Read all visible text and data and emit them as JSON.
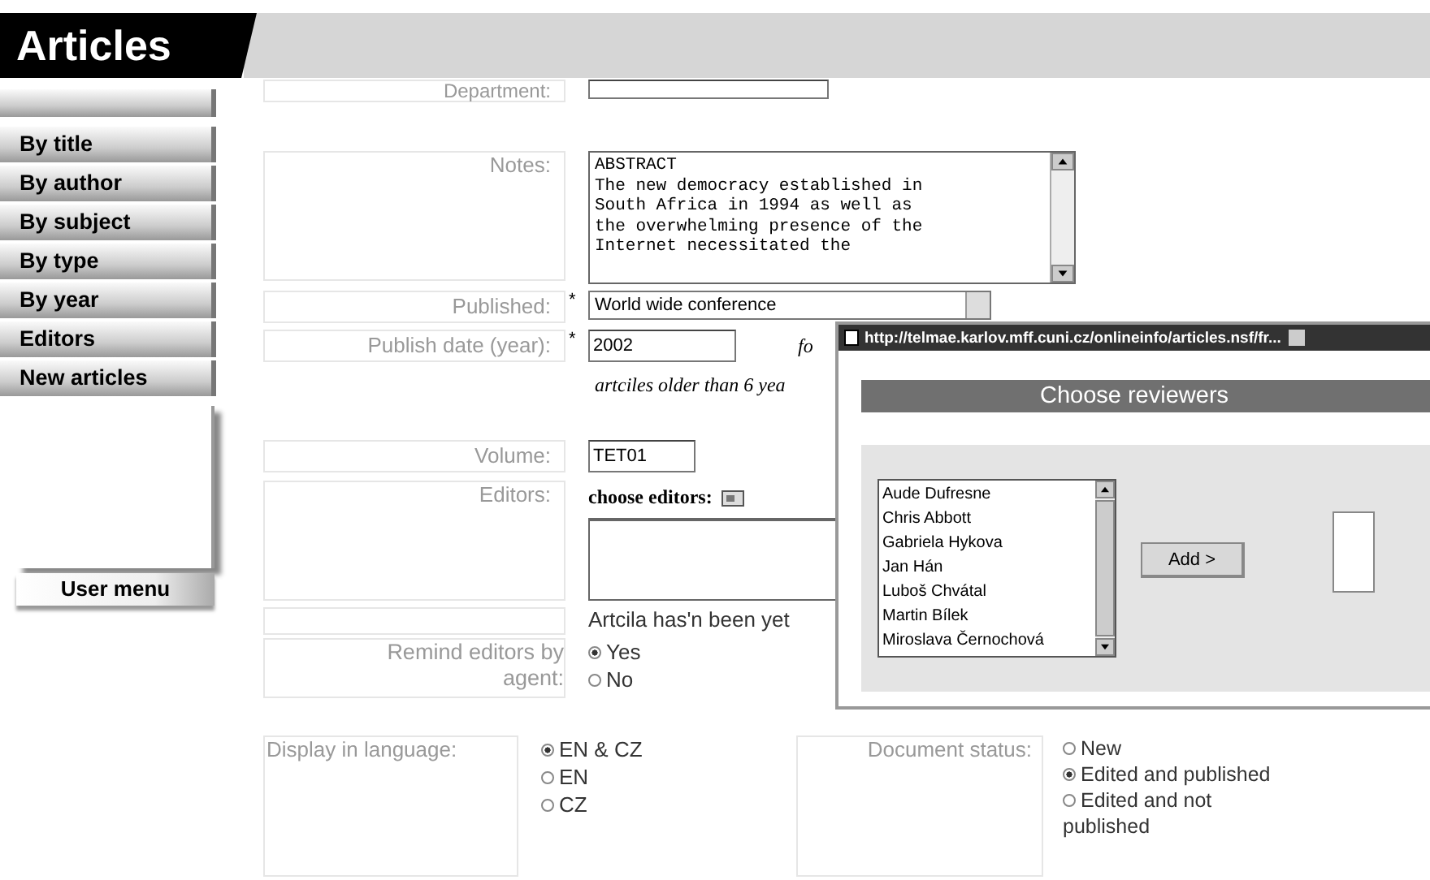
{
  "header": {
    "title": "Articles"
  },
  "sidebar": {
    "items": [
      {
        "label": "By title"
      },
      {
        "label": "By author"
      },
      {
        "label": "By subject"
      },
      {
        "label": "By type"
      },
      {
        "label": "By year"
      },
      {
        "label": "Editors"
      },
      {
        "label": "New articles"
      }
    ],
    "user_menu": "User menu"
  },
  "form": {
    "department": {
      "label": "Department:"
    },
    "notes": {
      "label": "Notes:",
      "value": "ABSTRACT\nThe new democracy established in\nSouth Africa in 1994 as well as\nthe overwhelming presence of the\nInternet necessitated the"
    },
    "published": {
      "label": "Published:",
      "required_mark": "*",
      "value": "World wide conference"
    },
    "publish_date": {
      "label": "Publish date (year):",
      "required_mark": "*",
      "value": "2002",
      "note": "fo",
      "hint": "artciles older than 6 yea"
    },
    "volume": {
      "label": "Volume:",
      "value": "TET01"
    },
    "editors": {
      "label": "Editors:",
      "choose": "choose editors:",
      "status": "Artcila has'n been yet"
    },
    "remind": {
      "label": "Remind editors by agent:",
      "options": [
        {
          "label": "Yes",
          "selected": true
        },
        {
          "label": "No",
          "selected": false
        }
      ]
    },
    "language": {
      "label": "Display in language:",
      "options": [
        {
          "label": "EN & CZ",
          "selected": true
        },
        {
          "label": "EN",
          "selected": false
        },
        {
          "label": "CZ",
          "selected": false
        }
      ]
    },
    "document_status": {
      "label": "Document status:",
      "options": [
        {
          "label": "New",
          "selected": false
        },
        {
          "label": "Edited and published",
          "selected": true
        },
        {
          "label": "Edited and not published",
          "selected": false
        }
      ]
    }
  },
  "popup": {
    "url": "http://telmae.karlov.mff.cuni.cz/onlineinfo/articles.nsf/fr...",
    "heading": "Choose reviewers",
    "reviewers": [
      "Aude Dufresne",
      "Chris Abbott",
      "Gabriela Hykova",
      "Jan Hán",
      "Luboš Chvátal",
      "Martin Bílek",
      "Miroslava Černochová"
    ],
    "add_button": "Add >"
  }
}
